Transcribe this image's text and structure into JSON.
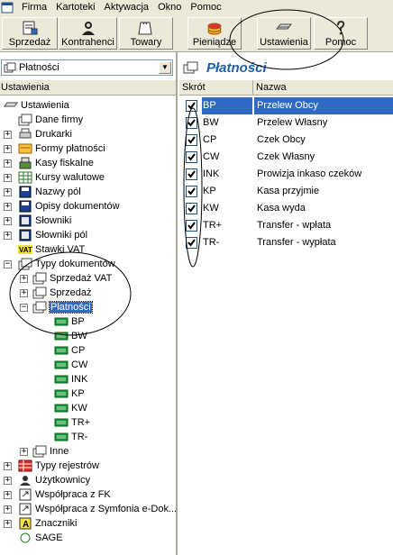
{
  "menu": [
    "Firma",
    "Kartoteki",
    "Aktywacja",
    "Okno",
    "Pomoc"
  ],
  "toolbar": {
    "sprzedaz": "Sprzedaż",
    "kontrahenci": "Kontrahenci",
    "towary": "Towary",
    "pieniadze": "Pieniądze",
    "ustawienia": "Ustawienia",
    "pomoc": "Pomoc"
  },
  "left": {
    "combo_value": "Płatności",
    "header": "Ustawienia",
    "tree": [
      {
        "label": "Ustawienia",
        "icon": "settings-icon"
      },
      {
        "label": "Dane firmy",
        "icon": "folder-icon"
      },
      {
        "label": "Drukarki",
        "icon": "printer-icon"
      },
      {
        "label": "Formy płatności",
        "icon": "payment-forms-icon"
      },
      {
        "label": "Kasy fiskalne",
        "icon": "cash-register-icon"
      },
      {
        "label": "Kursy walutowe",
        "icon": "currency-grid-icon"
      },
      {
        "label": "Nazwy pól",
        "icon": "disk-icon"
      },
      {
        "label": "Opisy dokumentów",
        "icon": "disk-icon"
      },
      {
        "label": "Słowniki",
        "icon": "dictionary-icon"
      },
      {
        "label": "Słowniki pól",
        "icon": "dictionary-icon"
      },
      {
        "label": "Stawki VAT",
        "icon": "vat-icon"
      },
      {
        "label": "Typy dokumentów",
        "icon": "documents-icon"
      },
      {
        "label": "Sprzedaż VAT",
        "icon": "documents-icon"
      },
      {
        "label": "Sprzedaż",
        "icon": "documents-icon"
      },
      {
        "label": "Płatności",
        "icon": "documents-icon"
      },
      {
        "label": "BP",
        "icon": "document-type-icon"
      },
      {
        "label": "BW",
        "icon": "document-type-icon"
      },
      {
        "label": "CP",
        "icon": "document-type-icon"
      },
      {
        "label": "CW",
        "icon": "document-type-icon"
      },
      {
        "label": "INK",
        "icon": "document-type-icon"
      },
      {
        "label": "KP",
        "icon": "document-type-icon"
      },
      {
        "label": "KW",
        "icon": "document-type-icon"
      },
      {
        "label": "TR+",
        "icon": "document-type-icon"
      },
      {
        "label": "TR-",
        "icon": "document-type-icon"
      },
      {
        "label": "Inne",
        "icon": "documents-icon"
      },
      {
        "label": "Typy rejestrów",
        "icon": "registers-icon"
      },
      {
        "label": "Użytkownicy",
        "icon": "users-icon"
      },
      {
        "label": "Współpraca z FK",
        "icon": "link-icon"
      },
      {
        "label": "Współpraca z Symfonia e-Dok...",
        "icon": "link-icon"
      },
      {
        "label": "Znaczniki",
        "icon": "markers-icon"
      },
      {
        "label": "SAGE",
        "icon": "sage-icon"
      }
    ]
  },
  "right": {
    "title": "Płatności",
    "columns": [
      "Skrót",
      "Nazwa"
    ],
    "rows": [
      {
        "code": "BP",
        "name": "Przelew Obcy",
        "checked": true
      },
      {
        "code": "BW",
        "name": "Przelew Własny",
        "checked": true
      },
      {
        "code": "CP",
        "name": "Czek Obcy",
        "checked": true
      },
      {
        "code": "CW",
        "name": "Czek Własny",
        "checked": true
      },
      {
        "code": "INK",
        "name": "Prowizja inkaso czeków",
        "checked": true
      },
      {
        "code": "KP",
        "name": "Kasa przyjmie",
        "checked": true
      },
      {
        "code": "KW",
        "name": "Kasa wyda",
        "checked": true
      },
      {
        "code": "TR+",
        "name": "Transfer - wpłata",
        "checked": true
      },
      {
        "code": "TR-",
        "name": "Transfer - wypłata",
        "checked": true
      }
    ]
  }
}
